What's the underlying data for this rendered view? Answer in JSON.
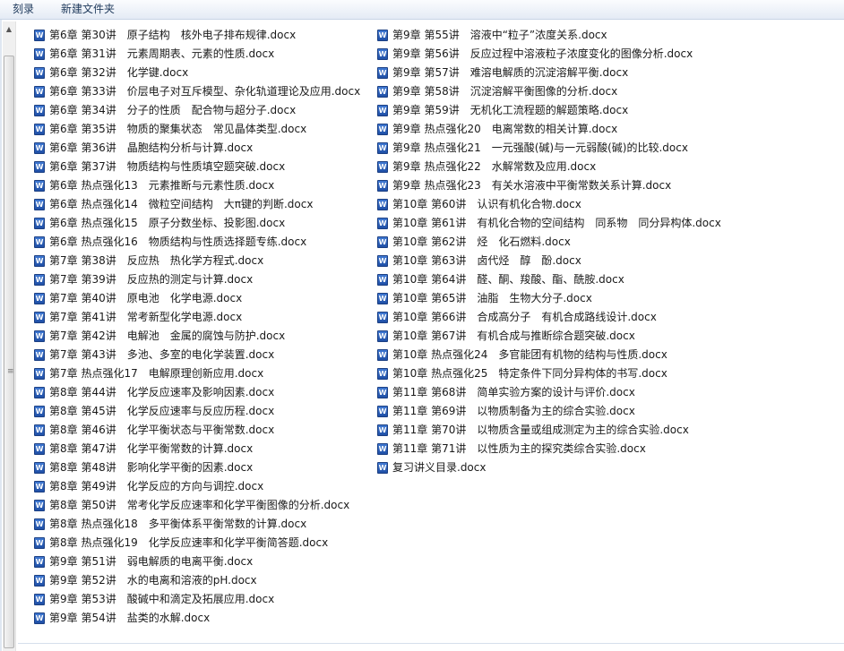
{
  "toolbar": {
    "burn_label": "刻录",
    "new_folder_label": "新建文件夹"
  },
  "icons": {
    "file_icon": "word-document-icon",
    "file_icon_glyph": "W",
    "file_icon_color": "#2b5fc1"
  },
  "files": [
    "第6章 第30讲　原子结构　核外电子排布规律.docx",
    "第6章 第31讲　元素周期表、元素的性质.docx",
    "第6章 第32讲　化学键.docx",
    "第6章 第33讲　价层电子对互斥模型、杂化轨道理论及应用.docx",
    "第6章 第34讲　分子的性质　配合物与超分子.docx",
    "第6章 第35讲　物质的聚集状态　常见晶体类型.docx",
    "第6章 第36讲　晶胞结构分析与计算.docx",
    "第6章 第37讲　物质结构与性质填空题突破.docx",
    "第6章 热点强化13　元素推断与元素性质.docx",
    "第6章 热点强化14　微粒空间结构　大π键的判断.docx",
    "第6章 热点强化15　原子分数坐标、投影图.docx",
    "第6章 热点强化16　物质结构与性质选择题专练.docx",
    "第7章 第38讲　反应热　热化学方程式.docx",
    "第7章 第39讲　反应热的测定与计算.docx",
    "第7章 第40讲　原电池　化学电源.docx",
    "第7章 第41讲　常考新型化学电源.docx",
    "第7章 第42讲　电解池　金属的腐蚀与防护.docx",
    "第7章 第43讲　多池、多室的电化学装置.docx",
    "第7章 热点强化17　电解原理创新应用.docx",
    "第8章 第44讲　化学反应速率及影响因素.docx",
    "第8章 第45讲　化学反应速率与反应历程.docx",
    "第8章 第46讲　化学平衡状态与平衡常数.docx",
    "第8章 第47讲　化学平衡常数的计算.docx",
    "第8章 第48讲　影响化学平衡的因素.docx",
    "第8章 第49讲　化学反应的方向与调控.docx",
    "第8章 第50讲　常考化学反应速率和化学平衡图像的分析.docx",
    "第8章 热点强化18　多平衡体系平衡常数的计算.docx",
    "第8章 热点强化19　化学反应速率和化学平衡简答题.docx",
    "第9章 第51讲　弱电解质的电离平衡.docx",
    "第9章 第52讲　水的电离和溶液的pH.docx",
    "第9章 第53讲　酸碱中和滴定及拓展应用.docx",
    "第9章 第54讲　盐类的水解.docx",
    "第9章 第55讲　溶液中“粒子”浓度关系.docx",
    "第9章 第56讲　反应过程中溶液粒子浓度变化的图像分析.docx",
    "第9章 第57讲　难溶电解质的沉淀溶解平衡.docx",
    "第9章 第58讲　沉淀溶解平衡图像的分析.docx",
    "第9章 第59讲　无机化工流程题的解题策略.docx",
    "第9章 热点强化20　电离常数的相关计算.docx",
    "第9章 热点强化21　一元强酸(碱)与一元弱酸(碱)的比较.docx",
    "第9章 热点强化22　水解常数及应用.docx",
    "第9章 热点强化23　有关水溶液中平衡常数关系计算.docx",
    "第10章 第60讲　认识有机化合物.docx",
    "第10章 第61讲　有机化合物的空间结构　同系物　同分异构体.docx",
    "第10章 第62讲　烃　化石燃料.docx",
    "第10章 第63讲　卤代烃　醇　酚.docx",
    "第10章 第64讲　醛、酮、羧酸、酯、酰胺.docx",
    "第10章 第65讲　油脂　生物大分子.docx",
    "第10章 第66讲　合成高分子　有机合成路线设计.docx",
    "第10章 第67讲　有机合成与推断综合题突破.docx",
    "第10章 热点强化24　多官能团有机物的结构与性质.docx",
    "第10章 热点强化25　特定条件下同分异构体的书写.docx",
    "第11章 第68讲　简单实验方案的设计与评价.docx",
    "第11章 第69讲　以物质制备为主的综合实验.docx",
    "第11章 第70讲　以物质含量或组成测定为主的综合实验.docx",
    "第11章 第71讲　以性质为主的探究类综合实验.docx",
    "复习讲义目录.docx"
  ]
}
